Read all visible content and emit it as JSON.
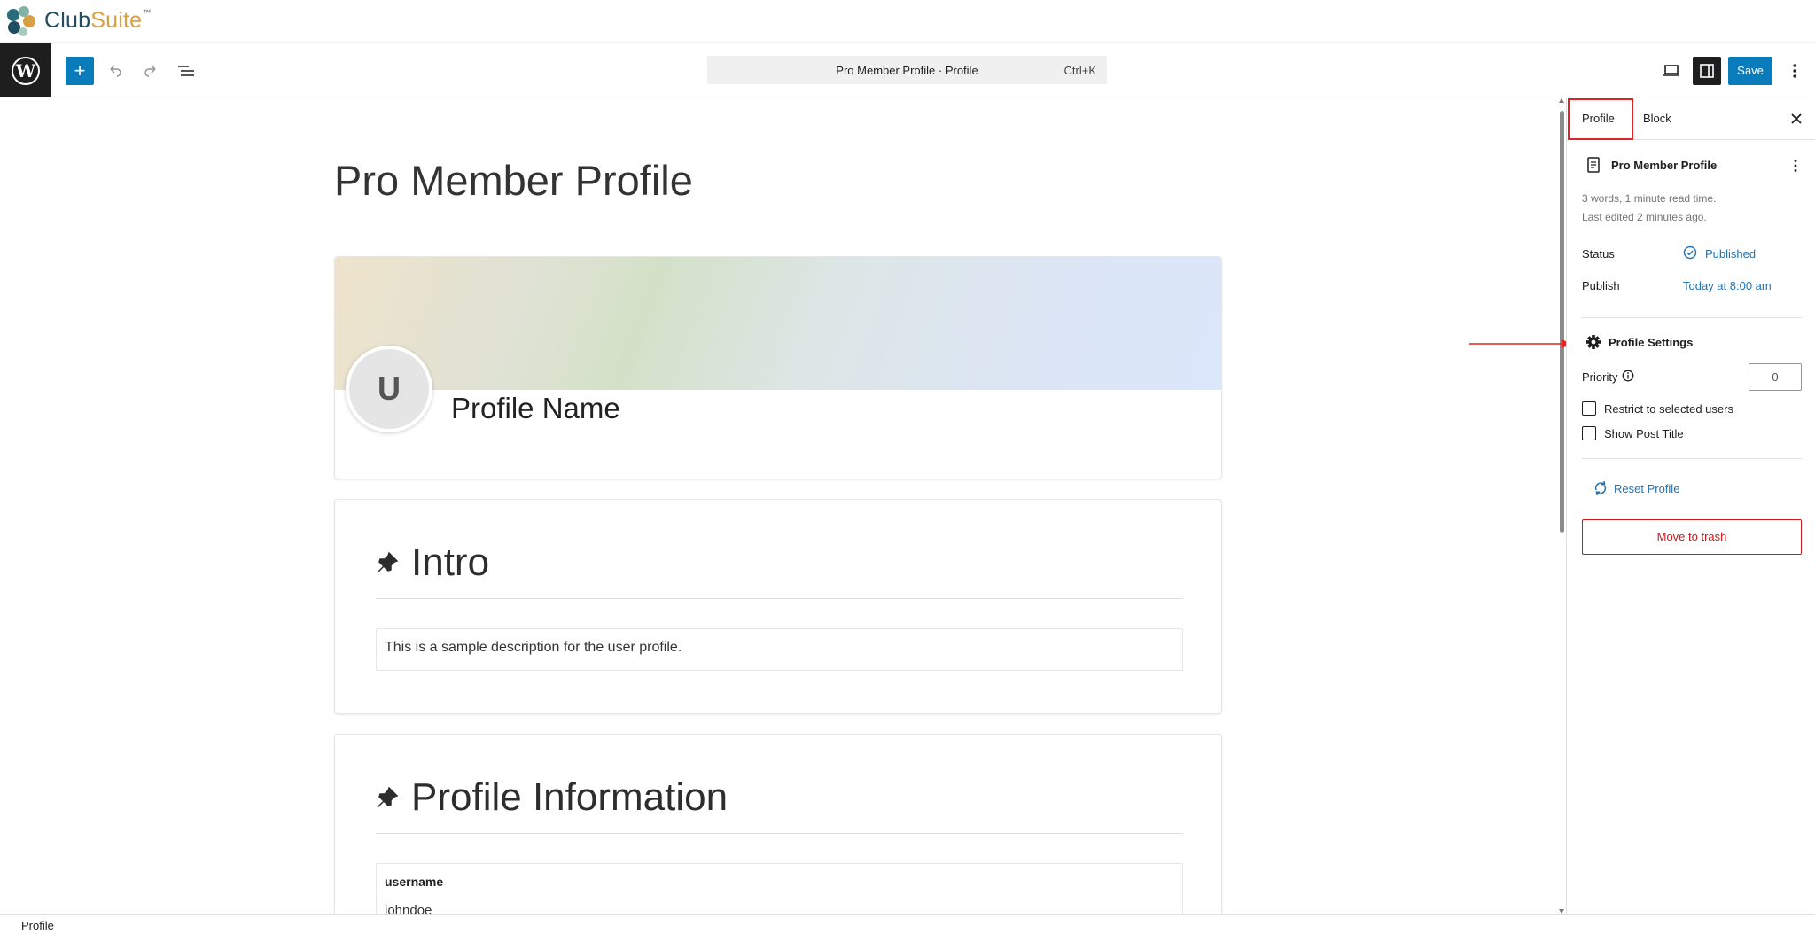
{
  "brand": {
    "name_part1": "Club",
    "name_part2": "Suite",
    "tm": "™"
  },
  "toolbar": {
    "add_label": "+",
    "command_title": "Pro Member Profile · Profile",
    "command_shortcut": "Ctrl+K",
    "save_label": "Save"
  },
  "editor": {
    "post_title": "Pro Member Profile",
    "avatar_initial": "U",
    "profile_name": "Profile Name",
    "intro_heading": "Intro",
    "intro_text": "This is a sample description for the user profile.",
    "info_heading": "Profile Information",
    "field_label": "username",
    "field_value": "johndoe"
  },
  "sidebar": {
    "tabs": [
      {
        "label": "Profile",
        "active": true
      },
      {
        "label": "Block",
        "active": false
      }
    ],
    "doc_title": "Pro Member Profile",
    "meta_words": "3 words, 1 minute read time.",
    "meta_edited": "Last edited 2 minutes ago.",
    "status_label": "Status",
    "status_value": "Published",
    "publish_label": "Publish",
    "publish_value": "Today at 8:00 am",
    "settings_title": "Profile Settings",
    "priority_label": "Priority",
    "priority_value": "0",
    "restrict_label": "Restrict to selected users",
    "show_title_label": "Show Post Title",
    "reset_label": "Reset Profile",
    "trash_label": "Move to trash"
  },
  "footer": {
    "breadcrumb": "Profile"
  },
  "colors": {
    "accent": "#0a7cbb",
    "link": "#2271b1",
    "danger": "#cc1818",
    "highlight": "#e02424"
  }
}
